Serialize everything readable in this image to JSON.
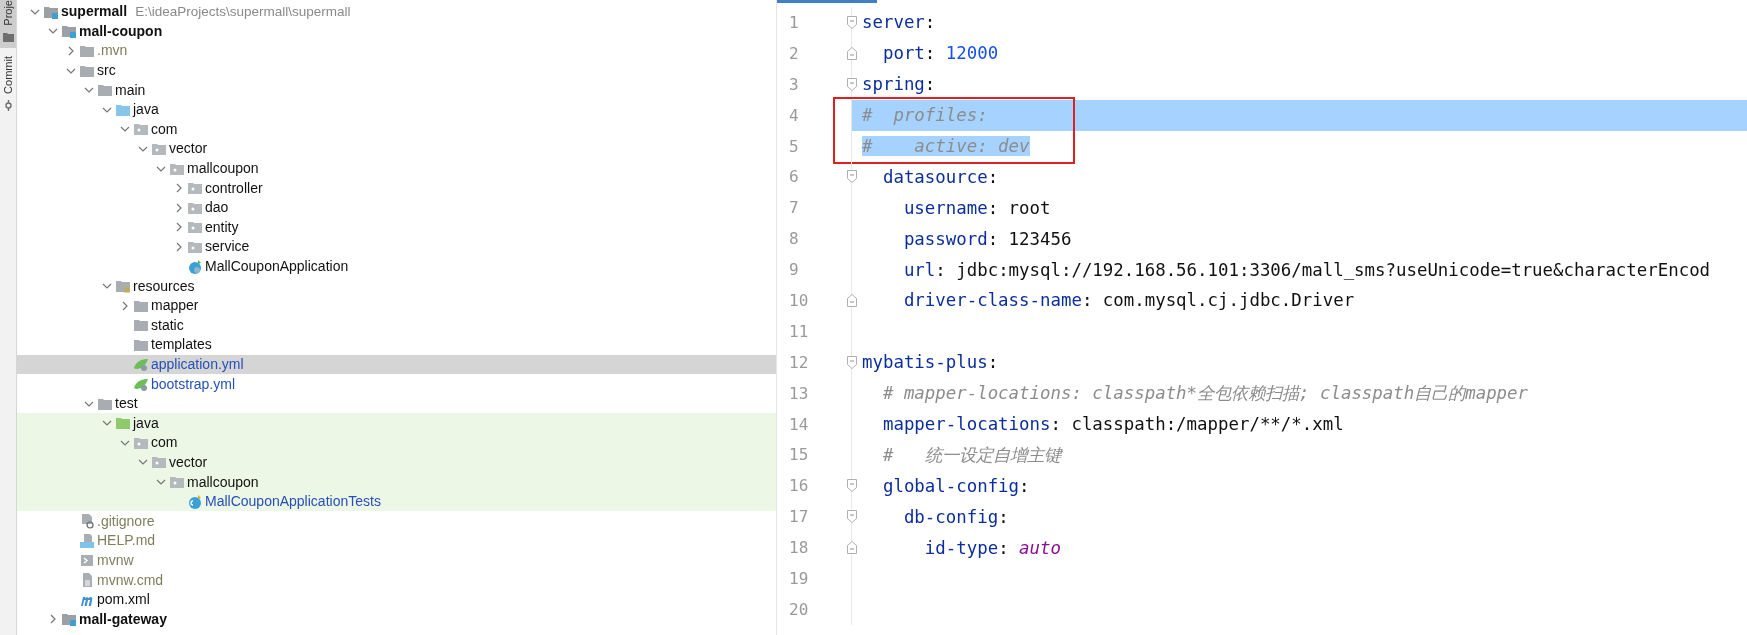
{
  "tool_tabs": [
    {
      "label": "Proje",
      "selected": true
    },
    {
      "label": "Commit",
      "selected": false
    }
  ],
  "tree": [
    {
      "label": "supermall",
      "kind": "module",
      "hint": "E:\\ideaProjects\\supermall\\supermall",
      "expanded": true,
      "selected": false,
      "children": [
        {
          "label": "mall-coupon",
          "kind": "module",
          "expanded": true,
          "selected": false,
          "children": [
            {
              "label": ".mvn",
              "kind": "folder",
              "color": "#7f7f5c",
              "expanded": false,
              "selected": false
            },
            {
              "label": "src",
              "kind": "folder",
              "expanded": true,
              "selected": false,
              "children": [
                {
                  "label": "main",
                  "kind": "folder",
                  "expanded": true,
                  "selected": false,
                  "children": [
                    {
                      "label": "java",
                      "kind": "source-folder",
                      "expanded": true,
                      "selected": false,
                      "children": [
                        {
                          "label": "com",
                          "kind": "package",
                          "expanded": true,
                          "selected": false,
                          "children": [
                            {
                              "label": "vector",
                              "kind": "package",
                              "expanded": true,
                              "selected": false,
                              "children": [
                                {
                                  "label": "mallcoupon",
                                  "kind": "package",
                                  "expanded": true,
                                  "selected": false,
                                  "children": [
                                    {
                                      "label": "controller",
                                      "kind": "package",
                                      "expanded": false,
                                      "selected": false
                                    },
                                    {
                                      "label": "dao",
                                      "kind": "package",
                                      "expanded": false,
                                      "selected": false
                                    },
                                    {
                                      "label": "entity",
                                      "kind": "package",
                                      "expanded": false,
                                      "selected": false
                                    },
                                    {
                                      "label": "service",
                                      "kind": "package",
                                      "expanded": false,
                                      "selected": false
                                    },
                                    {
                                      "label": "MallCouponApplication",
                                      "kind": "class",
                                      "selected": false
                                    }
                                  ]
                                }
                              ]
                            }
                          ]
                        }
                      ]
                    },
                    {
                      "label": "resources",
                      "kind": "resources-folder",
                      "expanded": true,
                      "selected": false,
                      "children": [
                        {
                          "label": "mapper",
                          "kind": "folder",
                          "expanded": false,
                          "selected": false
                        },
                        {
                          "label": "static",
                          "kind": "folder",
                          "selected": false
                        },
                        {
                          "label": "templates",
                          "kind": "folder",
                          "selected": false
                        },
                        {
                          "label": "application.yml",
                          "kind": "yaml",
                          "color": "#2450b8",
                          "selected": true
                        },
                        {
                          "label": "bootstrap.yml",
                          "kind": "yaml",
                          "color": "#2450b8",
                          "selected": false
                        }
                      ]
                    }
                  ]
                },
                {
                  "label": "test",
                  "kind": "folder",
                  "expanded": true,
                  "selected": false,
                  "children": [
                    {
                      "label": "java",
                      "kind": "test-folder",
                      "expanded": true,
                      "selected": false,
                      "children": [
                        {
                          "label": "com",
                          "kind": "package",
                          "expanded": true,
                          "selected": false,
                          "children": [
                            {
                              "label": "vector",
                              "kind": "package",
                              "expanded": true,
                              "selected": false,
                              "children": [
                                {
                                  "label": "mallcoupon",
                                  "kind": "package",
                                  "expanded": true,
                                  "selected": false,
                                  "children": [
                                    {
                                      "label": "MallCouponApplicationTests",
                                      "kind": "test-class",
                                      "color": "#2450b8",
                                      "selected": false
                                    }
                                  ]
                                }
                              ]
                            }
                          ]
                        }
                      ]
                    }
                  ]
                }
              ]
            },
            {
              "label": ".gitignore",
              "kind": "ignore-file",
              "color": "#7f7f5c",
              "selected": false
            },
            {
              "label": "HELP.md",
              "kind": "markdown",
              "color": "#7f7f5c",
              "selected": false
            },
            {
              "label": "mvnw",
              "kind": "script",
              "color": "#7f7f5c",
              "selected": false
            },
            {
              "label": "mvnw.cmd",
              "kind": "text-file",
              "color": "#7f7f5c",
              "selected": false
            },
            {
              "label": "pom.xml",
              "kind": "maven",
              "selected": false
            }
          ]
        },
        {
          "label": "mall-gateway",
          "kind": "module",
          "expanded": false,
          "selected": false
        }
      ]
    }
  ],
  "editor": {
    "lines": [
      {
        "number": "1",
        "fold_start": true,
        "tokens": [
          {
            "kind": "key",
            "text": "server"
          },
          {
            "kind": "punct",
            "text": ":"
          }
        ]
      },
      {
        "number": "2",
        "fold_end": true,
        "tokens": [
          {
            "kind": "key",
            "text": "  port"
          },
          {
            "kind": "punct",
            "text": ": "
          },
          {
            "kind": "number",
            "text": "12000"
          }
        ]
      },
      {
        "number": "3",
        "fold_start": true,
        "tokens": [
          {
            "kind": "key",
            "text": "spring"
          },
          {
            "kind": "punct",
            "text": ":"
          }
        ]
      },
      {
        "number": "4",
        "selected": true,
        "whole_line": true,
        "boxed": true,
        "tokens": [
          {
            "kind": "comment",
            "text": "#  profiles:"
          }
        ]
      },
      {
        "number": "5",
        "selected": true,
        "boxed": true,
        "tokens": [
          {
            "kind": "comment",
            "text": "#    active: dev"
          }
        ]
      },
      {
        "number": "6",
        "fold_start": true,
        "tokens": [
          {
            "kind": "key",
            "text": "  datasource"
          },
          {
            "kind": "punct",
            "text": ":"
          }
        ]
      },
      {
        "number": "7",
        "tokens": [
          {
            "kind": "key",
            "text": "    username"
          },
          {
            "kind": "punct",
            "text": ": "
          },
          {
            "kind": "value",
            "text": "root"
          }
        ]
      },
      {
        "number": "8",
        "tokens": [
          {
            "kind": "key",
            "text": "    password"
          },
          {
            "kind": "punct",
            "text": ": "
          },
          {
            "kind": "value",
            "text": "123456"
          }
        ]
      },
      {
        "number": "9",
        "tokens": [
          {
            "kind": "key",
            "text": "    url"
          },
          {
            "kind": "punct",
            "text": ": "
          },
          {
            "kind": "value",
            "text": "jdbc:mysql://192.168.56.101:3306/mall_sms?useUnicode=true&characterEncod"
          }
        ]
      },
      {
        "number": "10",
        "fold_end": true,
        "tokens": [
          {
            "kind": "key",
            "text": "    driver-class-name"
          },
          {
            "kind": "punct",
            "text": ": "
          },
          {
            "kind": "value",
            "text": "com.mysql.cj.jdbc.Driver"
          }
        ]
      },
      {
        "number": "11"
      },
      {
        "number": "12",
        "fold_start": true,
        "tokens": [
          {
            "kind": "key",
            "text": "mybatis-plus"
          },
          {
            "kind": "punct",
            "text": ":"
          }
        ]
      },
      {
        "number": "13",
        "tokens": [
          {
            "kind": "comment",
            "text": "  # mapper-locations: classpath*全包依赖扫描; classpath自己的mapper"
          }
        ]
      },
      {
        "number": "14",
        "tokens": [
          {
            "kind": "key",
            "text": "  mapper-locations"
          },
          {
            "kind": "punct",
            "text": ": "
          },
          {
            "kind": "value",
            "text": "classpath:/mapper/**/*.xml"
          }
        ]
      },
      {
        "number": "15",
        "tokens": [
          {
            "kind": "comment",
            "text": "  #   统一设定自增主键"
          }
        ]
      },
      {
        "number": "16",
        "fold_start": true,
        "tokens": [
          {
            "kind": "key",
            "text": "  global-config"
          },
          {
            "kind": "punct",
            "text": ":"
          }
        ]
      },
      {
        "number": "17",
        "fold_start": true,
        "tokens": [
          {
            "kind": "key",
            "text": "    db-config"
          },
          {
            "kind": "punct",
            "text": ":"
          }
        ]
      },
      {
        "number": "18",
        "fold_end": true,
        "tokens": [
          {
            "kind": "key",
            "text": "      id-type"
          },
          {
            "kind": "punct",
            "text": ": "
          },
          {
            "kind": "keyword",
            "text": "auto"
          }
        ]
      },
      {
        "number": "19"
      },
      {
        "number": "20"
      }
    ]
  }
}
